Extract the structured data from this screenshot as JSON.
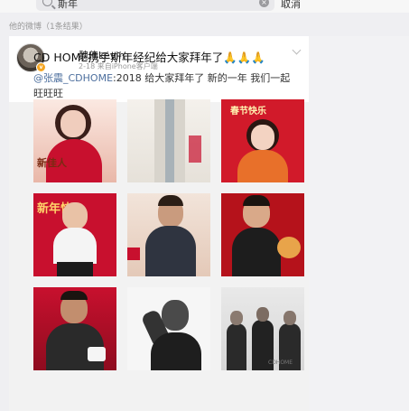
{
  "search": {
    "query": "斯年",
    "cancel_label": "取消"
  },
  "section_header": "他的微博（1条结果）",
  "post": {
    "username": "魏伟kevin",
    "meta": "2-18  来自iPhone客户端",
    "text": "CD HOME携手斯年经纪给大家拜年了🙏🙏🙏",
    "repost": {
      "mention": "@张震_CDHOME",
      "text": ":2018  给大家拜年了  新的一年 我们一起 旺旺旺"
    }
  },
  "images": [
    {
      "name": "photo-1",
      "caption": "新佳人"
    },
    {
      "name": "photo-2",
      "caption": ""
    },
    {
      "name": "photo-3",
      "caption": "春节快乐"
    },
    {
      "name": "photo-4",
      "caption": "新年快"
    },
    {
      "name": "photo-5",
      "caption": ""
    },
    {
      "name": "photo-6",
      "caption": ""
    },
    {
      "name": "photo-7",
      "caption": ""
    },
    {
      "name": "photo-8",
      "caption": ""
    },
    {
      "name": "photo-9",
      "caption": "CDHOME"
    }
  ],
  "colors": {
    "link": "#4d6f9e",
    "festive_red": "#c8102e",
    "badge": "#f5a623"
  }
}
